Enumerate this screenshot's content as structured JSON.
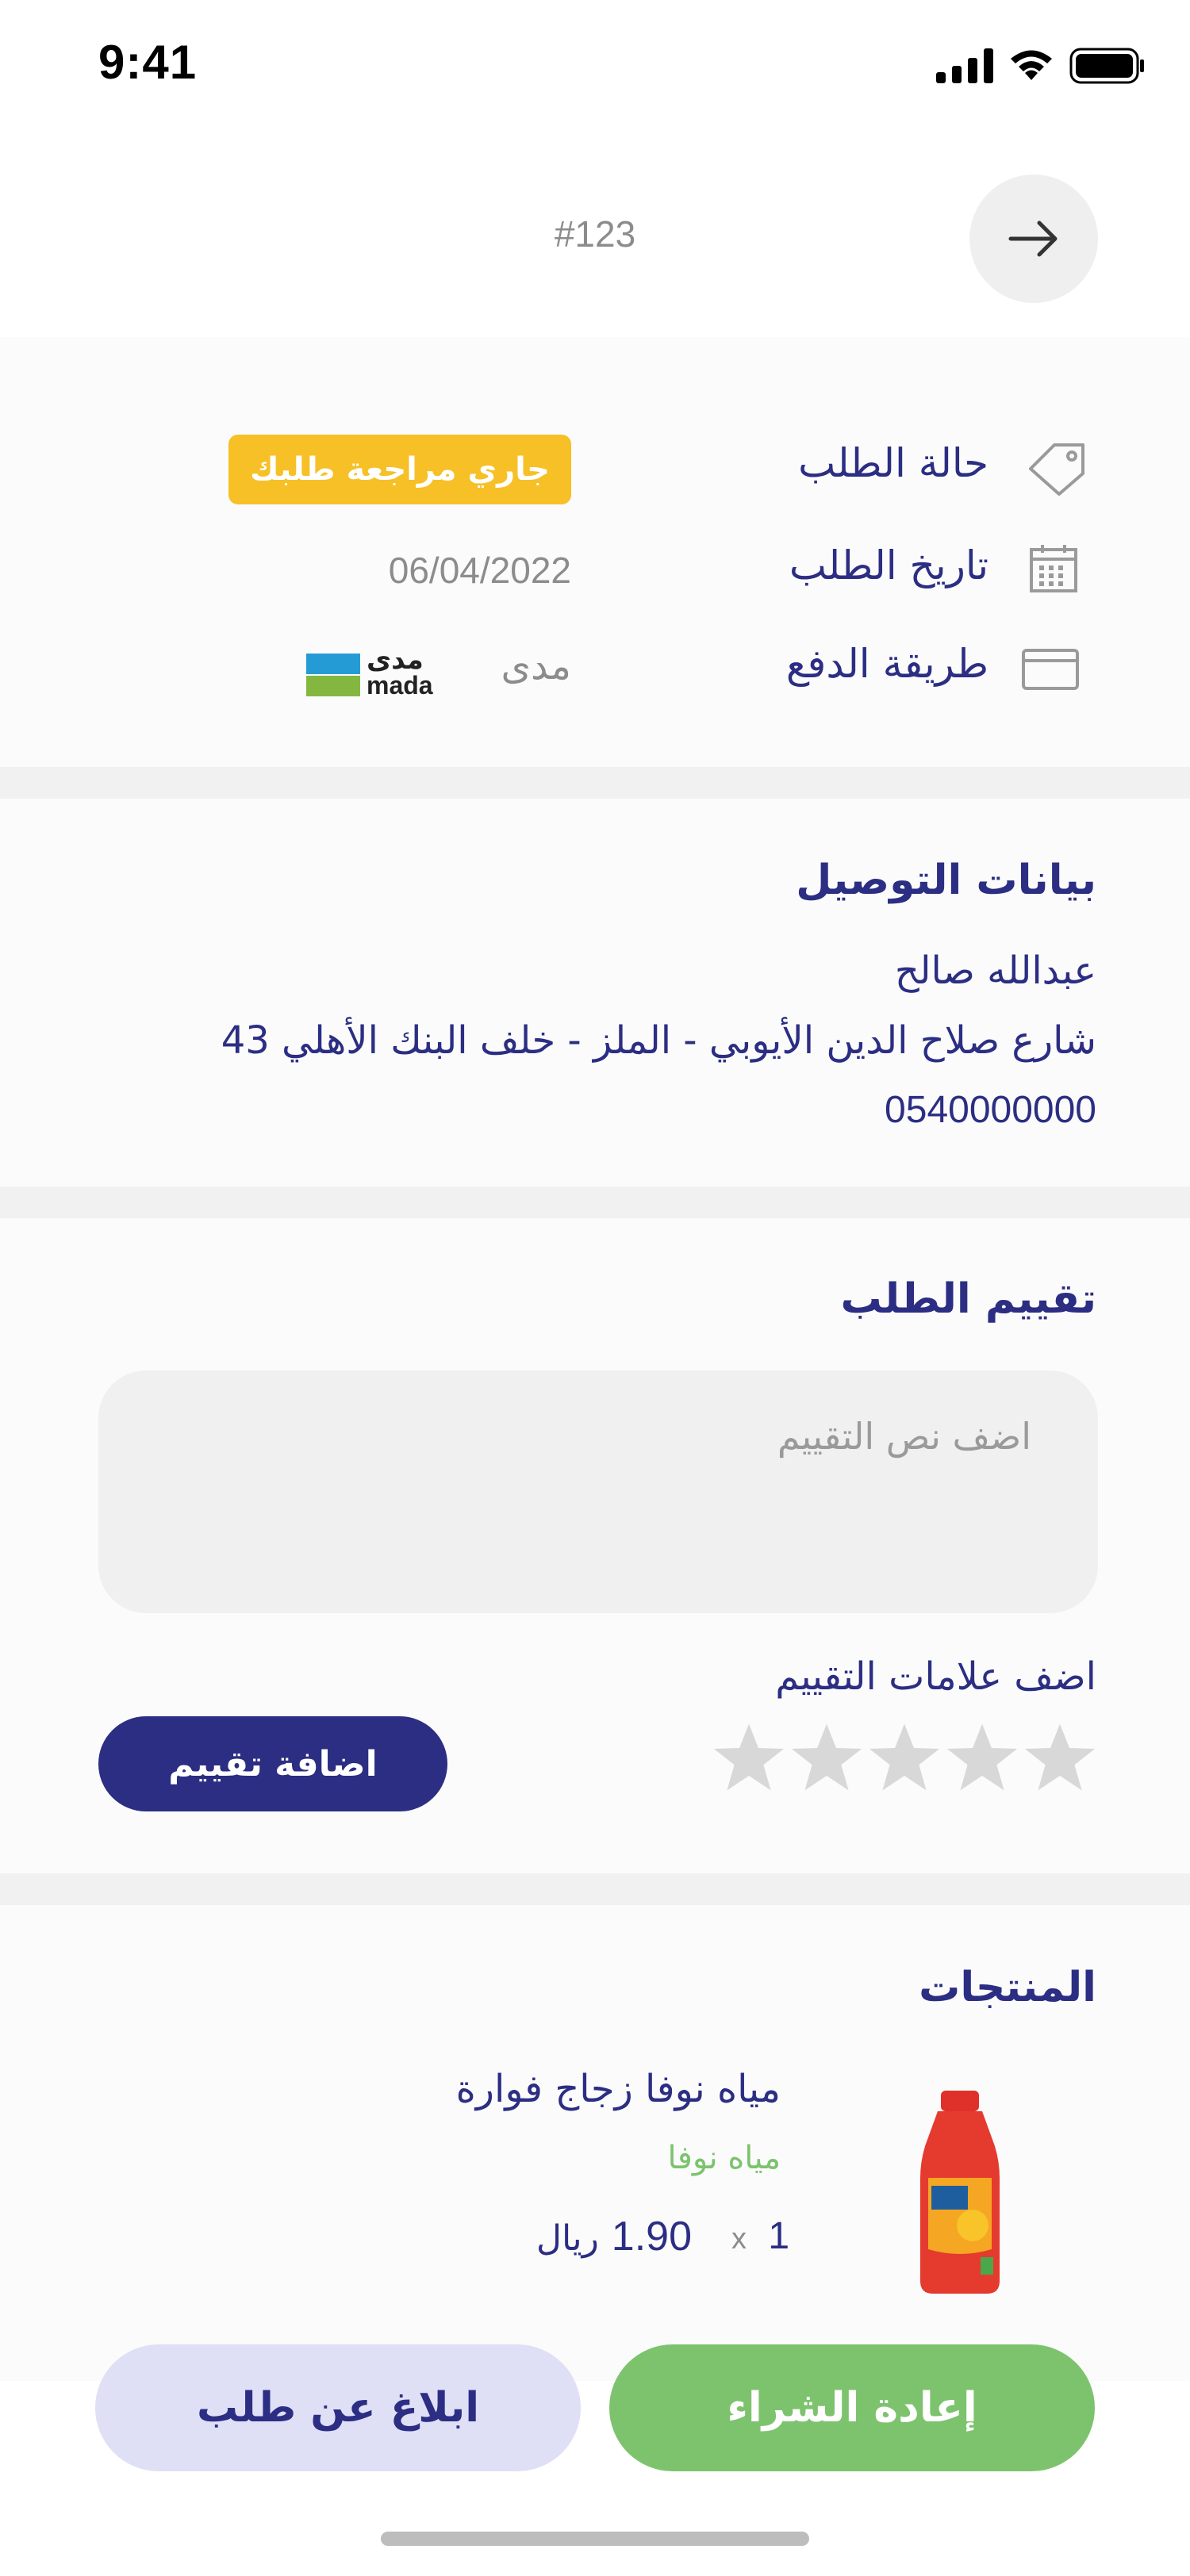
{
  "status_bar": {
    "time": "9:41"
  },
  "header": {
    "order_number": "#123",
    "back_icon": "arrow-right-icon"
  },
  "order_info": {
    "status_label": "حالة الطلب",
    "status_value": "جاري مراجعة طلبك",
    "status_color": "#F6C026",
    "date_label": "تاريخ الطلب",
    "date_value": "06/04/2022",
    "payment_label": "طريقة الدفع",
    "payment_value": "مدى",
    "payment_logo_text_ar": "مدى",
    "payment_logo_text_en": "mada"
  },
  "delivery": {
    "title": "بيانات التوصيل",
    "name": "عبدالله صالح",
    "address": "شارع صلاح الدين الأيوبي - الملز - خلف البنك الأهلي 43",
    "phone": "0540000000"
  },
  "review": {
    "title": "تقييم الطلب",
    "placeholder": "اضف نص التقييم",
    "stars_label": "اضف علامات التقييم",
    "rating": 0,
    "max_rating": 5,
    "add_button": "اضافة تقييم"
  },
  "products": {
    "title": "المنتجات",
    "items": [
      {
        "name": "مياه نوفا زجاج فوارة",
        "brand": "مياه نوفا",
        "quantity": "1",
        "qty_prefix": "x",
        "price": "1.90",
        "currency": "ريال"
      }
    ]
  },
  "actions": {
    "report_button": "ابلاغ عن طلب",
    "reorder_button": "إعادة الشراء"
  },
  "colors": {
    "primary": "#2B2E82",
    "accent_green": "#7DC36E",
    "badge_yellow": "#F6C026",
    "muted_gray": "#8C8C8C"
  }
}
